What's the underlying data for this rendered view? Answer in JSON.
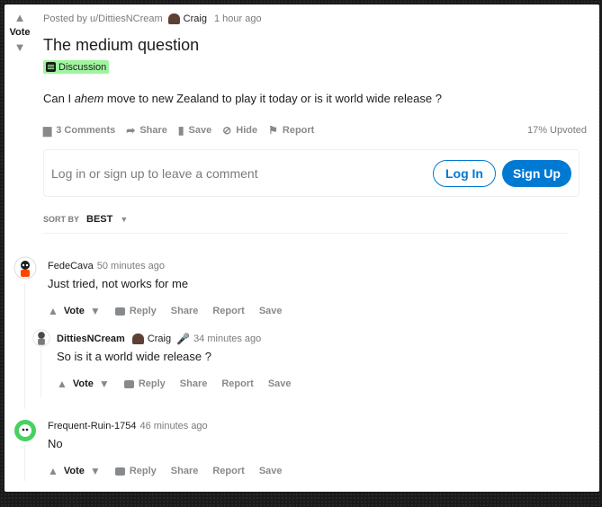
{
  "post": {
    "vote_label": "Vote",
    "posted_by": "Posted by u/DittiesNCream",
    "author_flair": "Craig",
    "time": "1 hour ago",
    "title": "The medium question",
    "tag": "Discussion",
    "body_pre": "Can I ",
    "body_em": "ahem",
    "body_post": " move to new Zealand to play it today or is it world wide release ?",
    "actions": {
      "comments": "3 Comments",
      "share": "Share",
      "save": "Save",
      "hide": "Hide",
      "report": "Report"
    },
    "upvoted": "17% Upvoted"
  },
  "login": {
    "prompt": "Log in or sign up to leave a comment",
    "login_label": "Log In",
    "signup_label": "Sign Up"
  },
  "sort": {
    "label": "SORT BY",
    "value": "BEST"
  },
  "comments": [
    {
      "author": "FedeCava",
      "time": "50 minutes ago",
      "text": "Just tried, not works for me",
      "vote": "Vote",
      "reply": "Reply",
      "share": "Share",
      "report": "Report",
      "save": "Save"
    },
    {
      "author": "DittiesNCream",
      "flair": "Craig",
      "time": "34 minutes ago",
      "text": "So is it a world wide release ?",
      "vote": "Vote",
      "reply": "Reply",
      "share": "Share",
      "report": "Report",
      "save": "Save"
    },
    {
      "author": "Frequent-Ruin-1754",
      "time": "46 minutes ago",
      "text": "No",
      "vote": "Vote",
      "reply": "Reply",
      "share": "Share",
      "report": "Report",
      "save": "Save"
    }
  ],
  "colors": {
    "accent": "#0079d3",
    "tag_bg": "#9ef59e",
    "page_bg": "#1a1a1b"
  }
}
